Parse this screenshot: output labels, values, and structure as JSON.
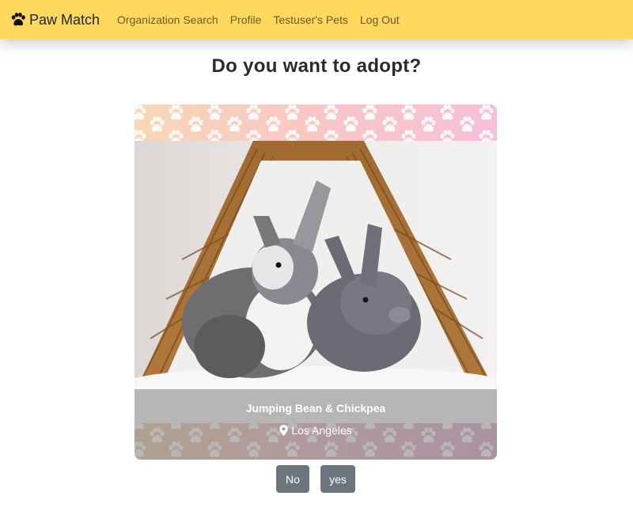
{
  "navbar": {
    "brand": "Paw Match",
    "brand_icon": "paw-icon",
    "links": [
      {
        "label": "Organization Search"
      },
      {
        "label": "Profile"
      },
      {
        "label": "Testuser's Pets"
      },
      {
        "label": "Log Out"
      }
    ],
    "background": "#ffd95e"
  },
  "main": {
    "title": "Do you want to adopt?",
    "card": {
      "pet_name": "Jumping Bean & Chickpea",
      "location": "Los Angeles",
      "location_icon": "map-pin-icon"
    },
    "buttons": {
      "no_label": "No",
      "yes_label": "yes"
    },
    "button_color": "#6c757d"
  }
}
